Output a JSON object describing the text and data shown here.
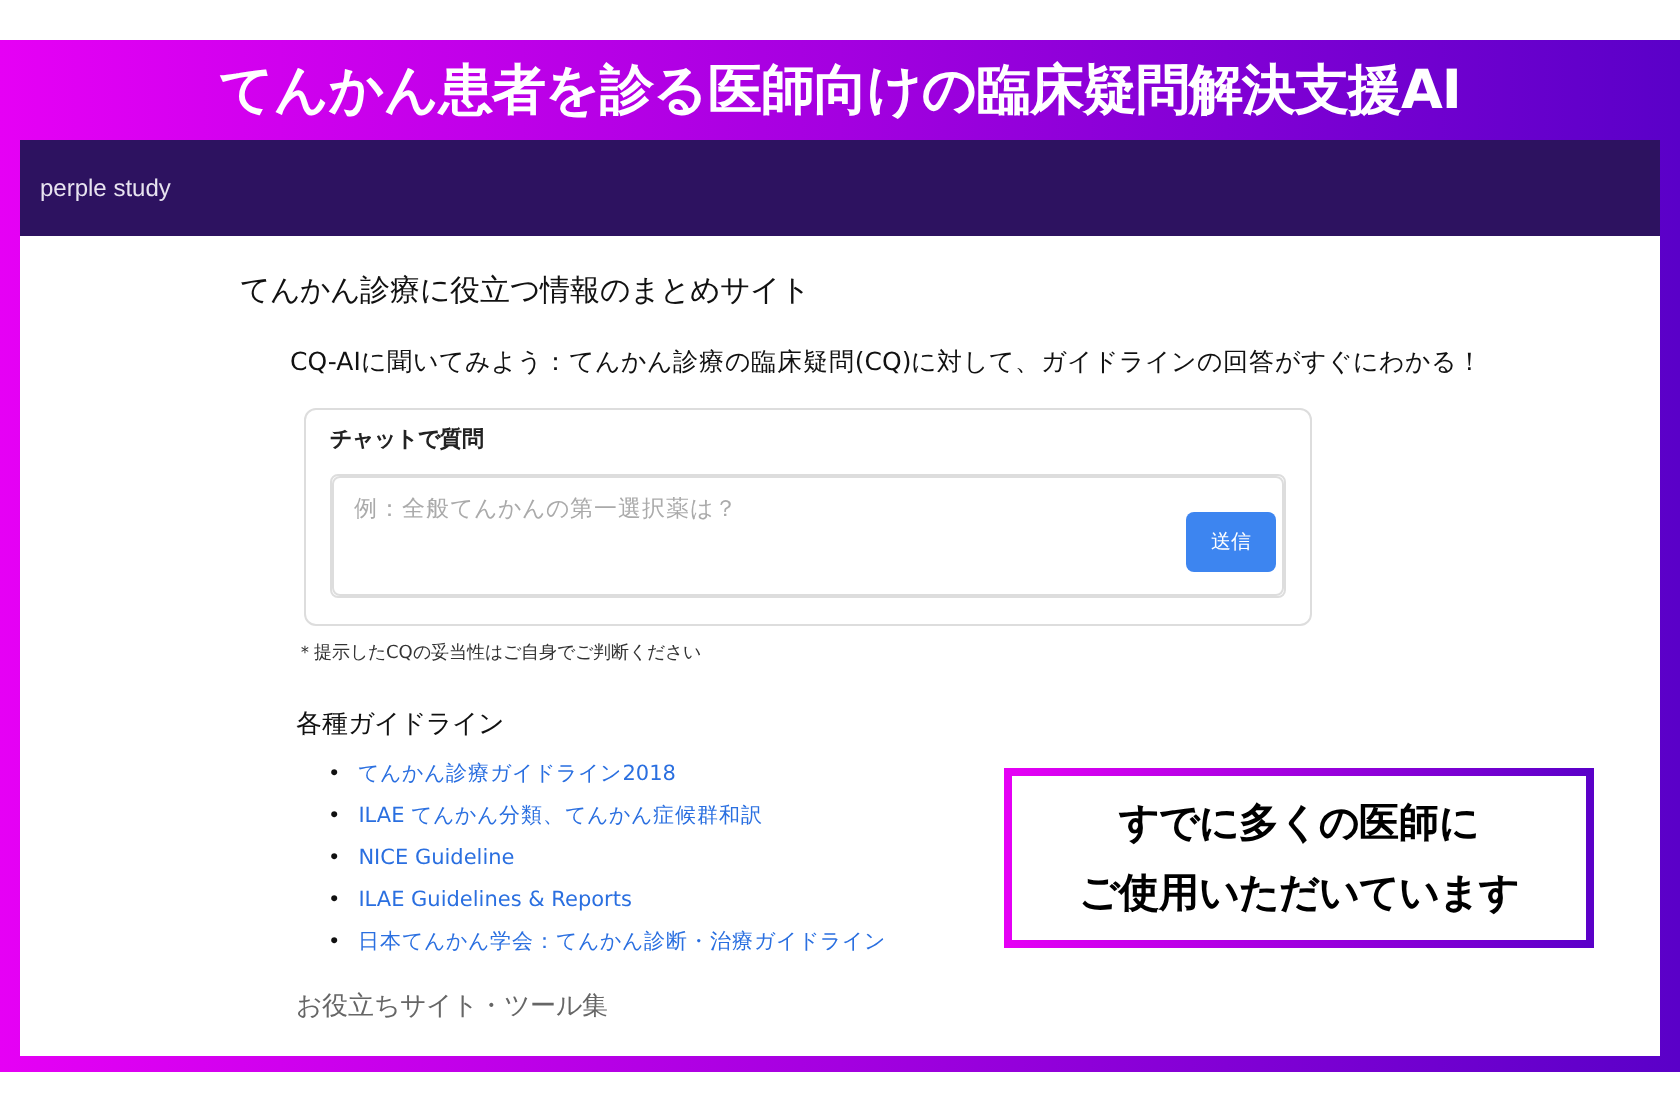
{
  "banner": {
    "title": "てんかん患者を診る医師向けの臨床疑問解決支援AI"
  },
  "navbar": {
    "brand": "perple study"
  },
  "page": {
    "heading": "てんかん診療に役立つ情報のまとめサイト",
    "intro": "CQ-AIに聞いてみよう：てんかん診療の臨床疑問(CQ)に対して、ガイドラインの回答がすぐにわかる！"
  },
  "chat": {
    "title": "チャットで質問",
    "placeholder": "例：全般てんかんの第一選択薬は？",
    "send_button": "送信",
    "note": "＊提示したCQの妥当性はご自身でご判断ください"
  },
  "guidelines": {
    "heading": "各種ガイドライン",
    "links": [
      {
        "bullet": "•",
        "label": "てんかん診療ガイドライン2018"
      },
      {
        "bullet": "•",
        "label": "ILAE てんかん分類、てんかん症候群和訳"
      },
      {
        "bullet": "•",
        "label": "NICE Guideline"
      },
      {
        "bullet": "•",
        "label": "ILAE Guidelines & Reports"
      },
      {
        "bullet": "•",
        "label": "日本てんかん学会：てんかん診断・治療ガイドライン"
      }
    ]
  },
  "next_section": {
    "heading": "お役立ちサイト・ツール集"
  },
  "callout": {
    "lines": [
      "すでに多くの医師に",
      "ご使用いただいています"
    ]
  }
}
